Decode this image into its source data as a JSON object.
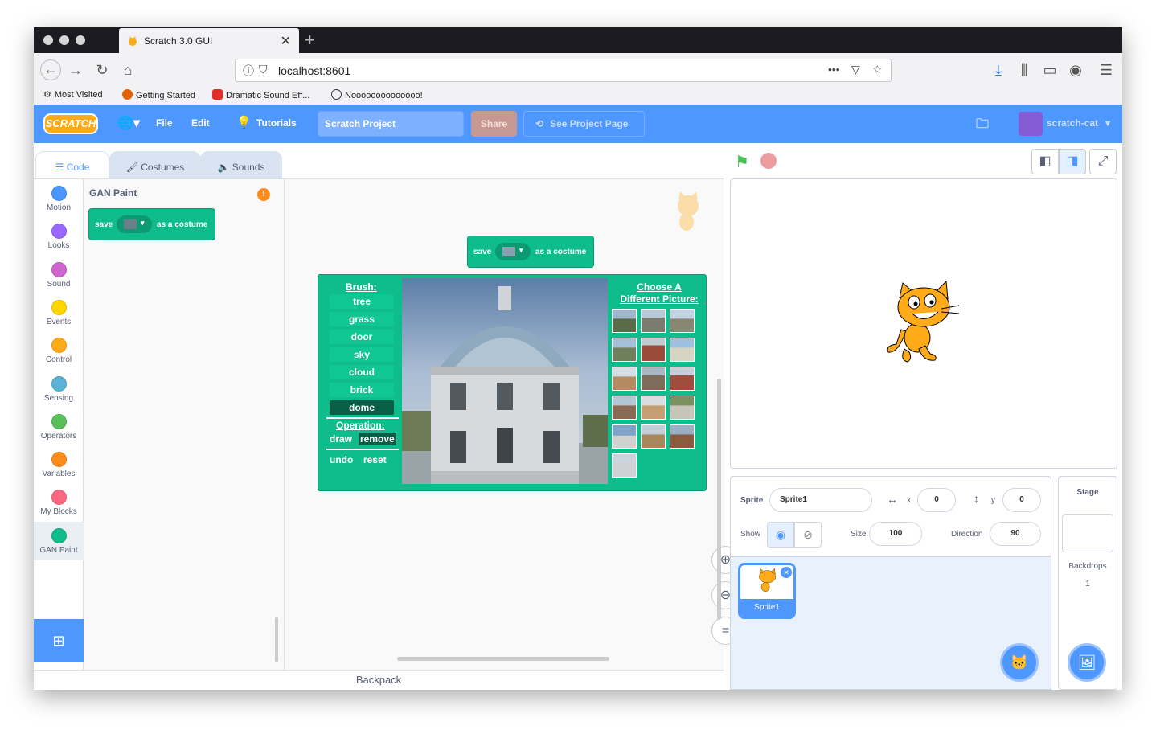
{
  "browser": {
    "tab_title": "Scratch 3.0 GUI",
    "url": "localhost:8601",
    "bookmarks": [
      "Most Visited",
      "Getting Started",
      "Dramatic Sound Eff...",
      "Noooooooooooooo!"
    ]
  },
  "menu": {
    "logo": "SCRATCH",
    "file": "File",
    "edit": "Edit",
    "tutorials": "Tutorials",
    "project_title": "Scratch Project",
    "share": "Share",
    "see_project_page": "See Project Page",
    "username": "scratch-cat"
  },
  "editor_tabs": {
    "code": "Code",
    "costumes": "Costumes",
    "sounds": "Sounds"
  },
  "categories": [
    {
      "label": "Motion",
      "color": "#4c97ff"
    },
    {
      "label": "Looks",
      "color": "#9966ff"
    },
    {
      "label": "Sound",
      "color": "#cf63cf"
    },
    {
      "label": "Events",
      "color": "#ffd500"
    },
    {
      "label": "Control",
      "color": "#ffab19"
    },
    {
      "label": "Sensing",
      "color": "#5cb1d6"
    },
    {
      "label": "Operators",
      "color": "#59c059"
    },
    {
      "label": "Variables",
      "color": "#ff8c1a"
    },
    {
      "label": "My Blocks",
      "color": "#ff6680"
    },
    {
      "label": "GAN Paint",
      "color": "#0fbd8c"
    }
  ],
  "palette": {
    "heading": "GAN Paint",
    "block_save": "save",
    "block_suffix": "as a costume"
  },
  "gan": {
    "brush_label": "Brush:",
    "brushes": [
      "tree",
      "grass",
      "door",
      "sky",
      "cloud",
      "brick",
      "dome"
    ],
    "selected_brush": "dome",
    "operation_label": "Operation:",
    "draw": "draw",
    "remove": "remove",
    "undo": "undo",
    "reset": "reset",
    "choose_line1": "Choose A",
    "choose_line2": "Different Picture:"
  },
  "backpack": "Backpack",
  "sprite_info": {
    "sprite_label": "Sprite",
    "sprite_name": "Sprite1",
    "x_label": "x",
    "x": "0",
    "y_label": "y",
    "y": "0",
    "show_label": "Show",
    "size_label": "Size",
    "size": "100",
    "direction_label": "Direction",
    "direction": "90"
  },
  "sprite_list": [
    {
      "name": "Sprite1"
    }
  ],
  "stage_panel": {
    "label": "Stage",
    "backdrops_label": "Backdrops",
    "backdrops_count": "1"
  }
}
